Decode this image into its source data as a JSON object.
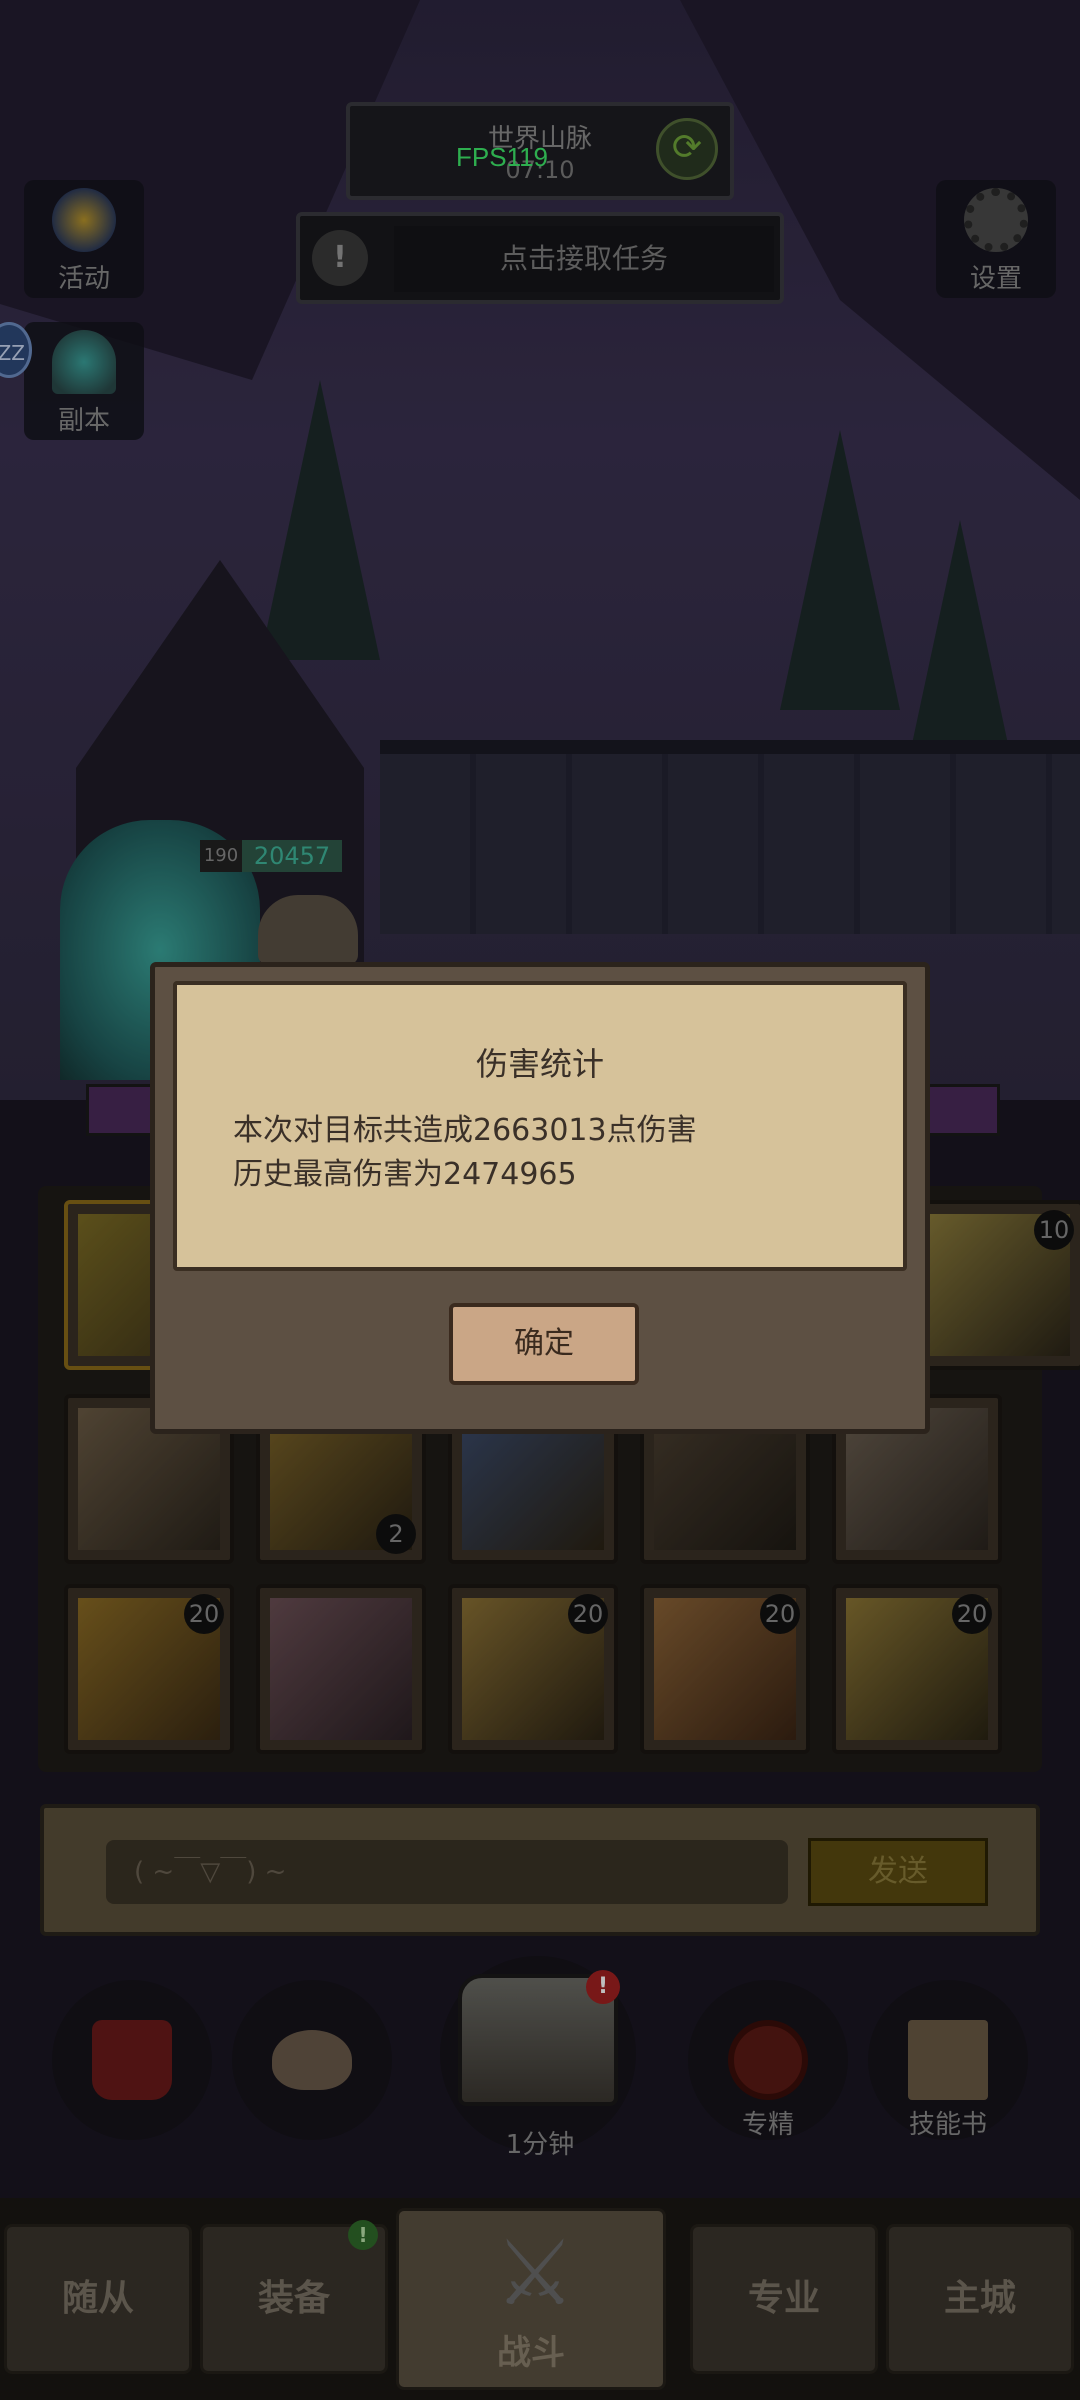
{
  "header": {
    "location_title": "世界山脉",
    "location_sub": "07:10",
    "fps": "FPS119",
    "refresh_icon": "refresh-icon",
    "task_text": "点击接取任务",
    "task_warn": "!"
  },
  "side": {
    "activity_label": "活动",
    "dungeon_label": "副本",
    "settings_label": "设置",
    "edge_badge": "ZZ"
  },
  "unit": {
    "level": "190",
    "hp": "20457"
  },
  "grid": {
    "badges": [
      "10",
      "2",
      "20",
      "20",
      "20",
      "20"
    ]
  },
  "chat": {
    "placeholder": "( ~￣▽￣) ~",
    "send_label": "发送"
  },
  "actions": {
    "chest_label": "1分钟",
    "chest_alert": "!",
    "specialize_label": "专精",
    "skillbook_label": "技能书"
  },
  "nav": {
    "followers": "随从",
    "equipment": "装备",
    "equipment_alert": "!",
    "battle": "战斗",
    "profession": "专业",
    "main_city": "主城"
  },
  "dialog": {
    "title": "伤害统计",
    "line1": "本次对目标共造成2663013点伤害",
    "line2": "历史最高伤害为2474965",
    "confirm": "确定"
  },
  "colors": {
    "fps_green": "#3ee86a",
    "dialog_paper": "#d6c29a",
    "dialog_frame": "#5d5043"
  }
}
